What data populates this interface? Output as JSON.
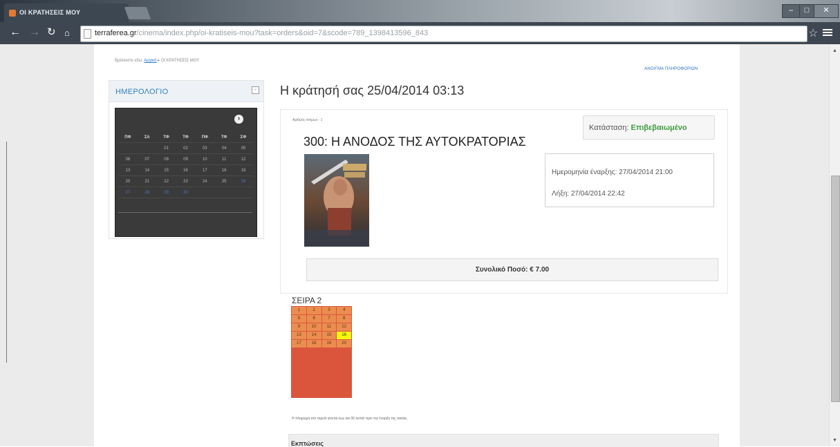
{
  "browser": {
    "tab_title": "ΟΙ ΚΡΑΤΗΣΕΙΣ ΜΟΥ",
    "url_host": "terraferea.gr",
    "url_path": "/cinema/index.php/oi-kratiseis-mou?task=orders&oid=7&scode=789_1398413596_843",
    "window_controls": [
      "–",
      "□",
      "✕"
    ]
  },
  "breadcrumb": {
    "prefix": "Βρίσκεστε εδώ:",
    "home": "Αρχική",
    "separator": "▸",
    "current": "ΟΙ ΚΡΑΤΗΣΕΙΣ ΜΟΥ"
  },
  "info_link": "ΑΝΟΙΓΜΑ ΠΛΗΡΟΦΟΡΙΩΝ",
  "calendar": {
    "title": "ΗΜΕΡΟΛΟΓΙΟ",
    "toggle": "-",
    "next": "›",
    "day_names": [
      "ΠΦ",
      "ΣΑ",
      "ΤΦ",
      "ΤΦ",
      "ΠΦ",
      "ΤΦ",
      "ΣΦ"
    ],
    "weeks": [
      [
        "",
        "",
        "01",
        "02",
        "03",
        "04",
        "05"
      ],
      [
        "06",
        "07",
        "08",
        "09",
        "10",
        "11",
        "12"
      ],
      [
        "13",
        "14",
        "15",
        "16",
        "17",
        "18",
        "19"
      ],
      [
        "20",
        "21",
        "22",
        "23",
        "24",
        "25",
        "26"
      ],
      [
        "27",
        "28",
        "29",
        "30",
        "",
        "",
        ""
      ]
    ]
  },
  "order": {
    "heading": "Η κράτησή σας 25/04/2014 03:13",
    "number_label": "Αριθμός ατόμων : 1",
    "status_label": "Κατάσταση:",
    "status_value": "Επιβεβαιωμένο",
    "movie_title": "300: Η ΑΝΟΔΟΣ ΤΗΣ ΑΥΤΟΚΡΑΤΟΡΙΑΣ",
    "start_label": "Ημερομηνία έναρξης: 27/04/2014 21:00",
    "end_label": "Λήξη: 27/04/2014 22:42",
    "total": "Συνολικό Ποσό: € 7.00",
    "row_label": "ΣΕΙΡΑ 2",
    "seats": [
      [
        "1",
        "2",
        "3",
        "4"
      ],
      [
        "5",
        "6",
        "7",
        "8"
      ],
      [
        "9",
        "10",
        "11",
        "12"
      ],
      [
        "13",
        "14",
        "15",
        "16"
      ],
      [
        "17",
        "18",
        "19",
        "20"
      ]
    ],
    "selected_seat": "16",
    "note": "Η πληρωμή στο ταμείο γίνεται έως και 30 λεπτά πριν την έναρξη της ταινίας",
    "events_title": "Εκπτώσεις"
  },
  "colors": {
    "status_green": "#3e9a3e",
    "seat_orange": "#eb8d4f",
    "seat_selected": "#f6f70c",
    "screen_red": "#db553d",
    "link_blue": "#2e7fbf"
  }
}
